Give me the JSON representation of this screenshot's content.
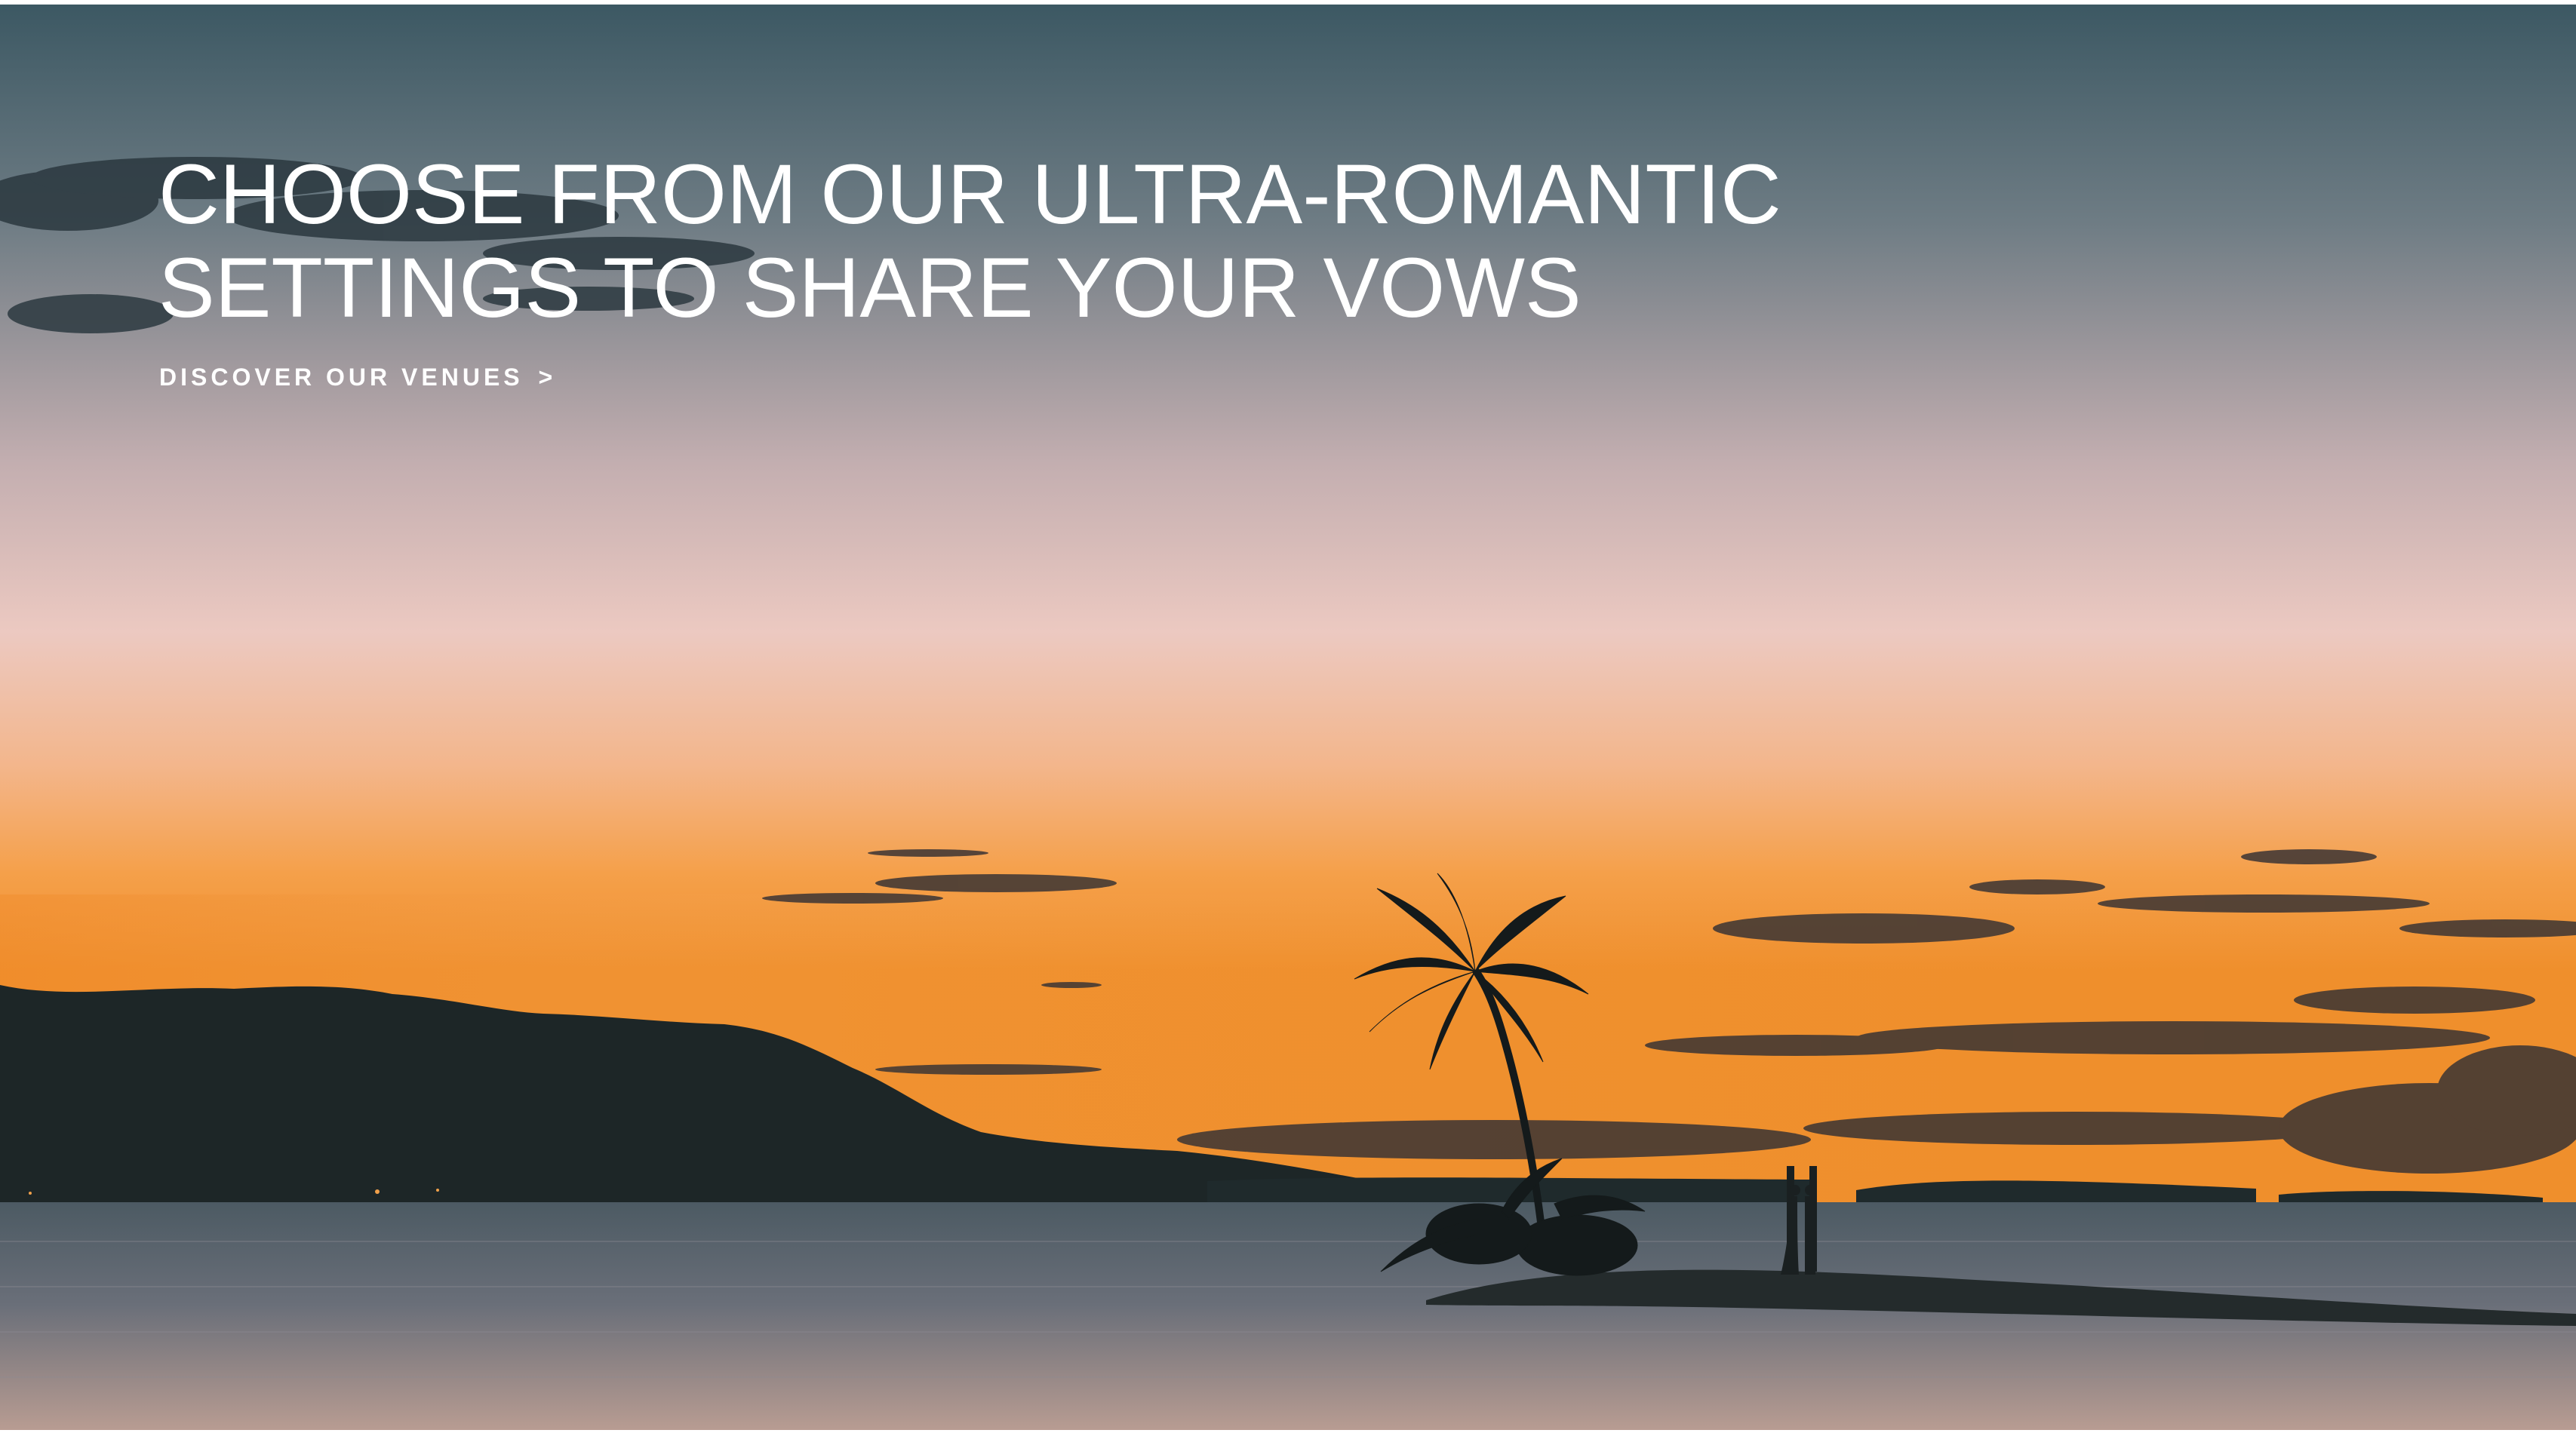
{
  "hero": {
    "headline_line1": "CHOOSE FROM OUR ULTRA-ROMANTIC",
    "headline_line2": "SETTINGS TO SHARE YOUR VOWS",
    "cta_label": "DISCOVER OUR VENUES",
    "cta_chevron": ">"
  },
  "colors": {
    "sky_top": "#3f5b66",
    "sky_mid": "#e8c8c0",
    "sky_horizon": "#f29a38",
    "land_silhouette": "#1f2a2c",
    "water": "#5f6a74",
    "text": "#ffffff"
  },
  "icons": {
    "cta_chevron": "chevron-right-icon"
  }
}
